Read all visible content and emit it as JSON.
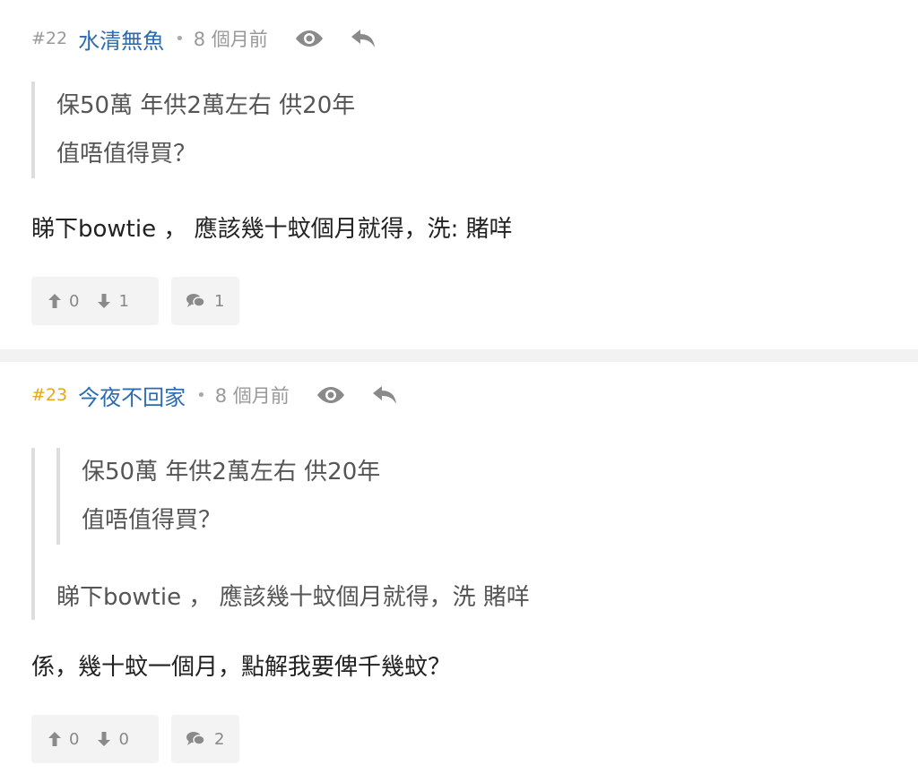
{
  "posts": [
    {
      "floor": "#22",
      "author": "水清無魚",
      "separator": "•",
      "time": "8 個月前",
      "quote_lines": [
        "保50萬 年供2萬左右 供20年",
        "值唔值得買？"
      ],
      "reply": "睇下bowtie ， 應該幾十蚊個月就得，洗: 賭咩",
      "upvotes": "0",
      "downvotes": "1",
      "comments": "1"
    },
    {
      "floor": "#23",
      "author": "今夜不回家",
      "separator": "•",
      "time": "8 個月前",
      "inner_quote_lines": [
        "保50萬 年供2萬左右 供20年",
        "值唔值得買？"
      ],
      "outer_quote_text": "睇下bowtie ， 應該幾十蚊個月就得，洗  賭咩",
      "reply": "係，幾十蚊一個月，點解我要俾千幾蚊？",
      "upvotes": "0",
      "downvotes": "0",
      "comments": "2"
    }
  ],
  "icons": {
    "view": "eye-icon",
    "reply": "reply-icon",
    "upvote": "arrow-up-icon",
    "downvote": "arrow-down-icon",
    "comment": "comments-icon"
  },
  "colors": {
    "author": "#2b6cb0",
    "highlight_floor": "#e6a817",
    "muted": "#999999"
  }
}
